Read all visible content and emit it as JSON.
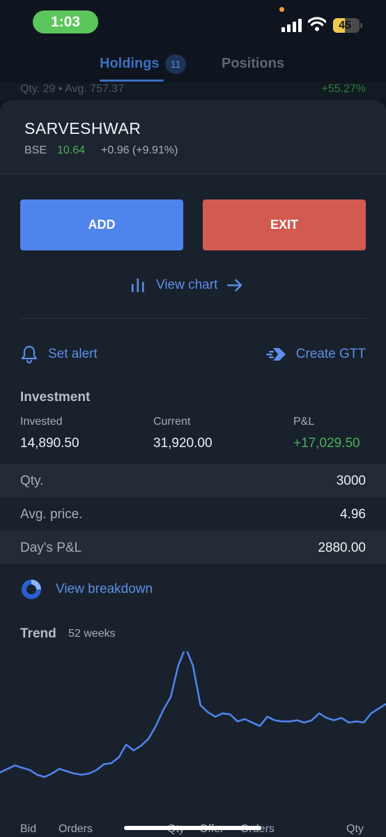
{
  "status_bar": {
    "time": "1:03",
    "battery": "45",
    "battery_level": 0.45
  },
  "tabs": {
    "holdings_label": "Holdings",
    "holdings_count": "11",
    "positions_label": "Positions"
  },
  "behind_row": {
    "left_text": "Qty. 29  •  Avg. 757.37",
    "right_text": "+55.27%"
  },
  "stock": {
    "name": "SARVESHWAR",
    "exchange": "BSE",
    "ltp": "10.64",
    "change": "+0.96 (+9.91%)"
  },
  "actions": {
    "add_label": "ADD",
    "exit_label": "EXIT",
    "view_chart_label": "View chart",
    "set_alert_label": "Set alert",
    "create_gtt_label": "Create GTT"
  },
  "investment": {
    "title": "Investment",
    "invested_label": "Invested",
    "invested_value": "14,890.50",
    "current_label": "Current",
    "current_value": "31,920.00",
    "pnl_label": "P&L",
    "pnl_value": "+17,029.50"
  },
  "details": [
    {
      "key": "Qty.",
      "value": "3000"
    },
    {
      "key": "Avg. price.",
      "value": "4.96"
    },
    {
      "key": "Day's P&L",
      "value": "2880.00"
    }
  ],
  "breakdown_label": "View breakdown",
  "trend": {
    "title": "Trend",
    "subtitle": "52 weeks"
  },
  "footer_labels": [
    "Bid",
    "Orders",
    "Qty",
    "Offer",
    "Orders",
    "Qty"
  ],
  "colors": {
    "accent": "#5c8fe6",
    "add": "#4e84ec",
    "exit": "#d35a50",
    "positive": "#4caf5a"
  },
  "chart_data": {
    "type": "line",
    "series": [
      {
        "values": [
          4.6,
          4.75,
          4.9,
          4.8,
          4.7,
          4.5,
          4.4,
          4.55,
          4.75,
          4.65,
          4.55,
          4.5,
          4.55,
          4.7,
          4.95,
          5.0,
          5.25,
          5.8,
          5.55,
          5.75,
          6.05,
          6.6,
          7.3,
          7.85,
          9.2,
          10.0,
          9.2,
          7.5,
          7.2,
          7.0,
          7.15,
          7.1,
          6.8,
          6.9,
          6.75,
          6.6,
          7.0,
          6.85,
          6.8,
          6.8,
          6.85,
          6.75,
          6.85,
          7.15,
          6.95,
          6.85,
          6.95,
          6.75,
          6.8,
          6.75,
          7.15,
          7.35,
          7.55
        ]
      }
    ]
  }
}
